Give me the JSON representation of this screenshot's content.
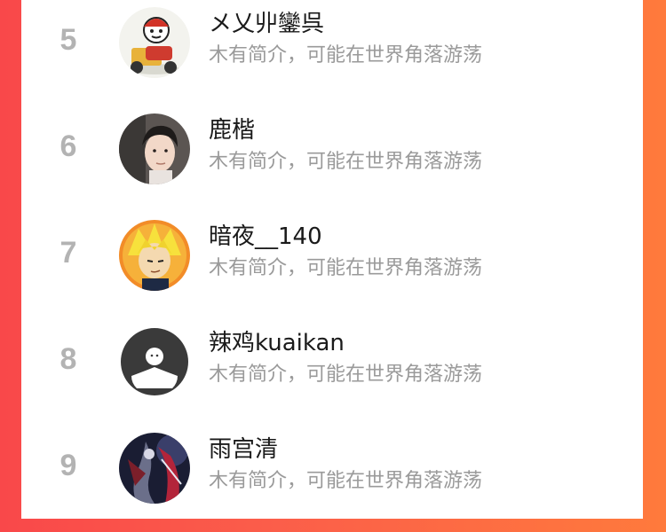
{
  "users": [
    {
      "rank": "5",
      "name": "メ乂丱鑾呉",
      "bio": "木有简介，可能在世界角落游荡",
      "avatar": "delivery-rider-cartoon-avatar"
    },
    {
      "rank": "6",
      "name": "鹿楷",
      "bio": "木有简介，可能在世界角落游荡",
      "avatar": "young-man-portrait-avatar"
    },
    {
      "rank": "7",
      "name": "暗夜__140",
      "bio": "木有简介，可能在世界角落游荡",
      "avatar": "anime-blond-character-avatar"
    },
    {
      "rank": "8",
      "name": "辣鸡kuaikan",
      "bio": "木有简介，可能在世界角落游荡",
      "avatar": "default-user-avatar"
    },
    {
      "rank": "9",
      "name": "雨宫清",
      "bio": "木有简介，可能在世界角落游荡",
      "avatar": "dark-fantasy-character-avatar"
    }
  ],
  "colors": {
    "background_left": "#f9484a",
    "background_right": "#ff7a3c",
    "rank": "#b3b3b3",
    "name": "#1a1a1a",
    "bio": "#9a9a9a"
  }
}
